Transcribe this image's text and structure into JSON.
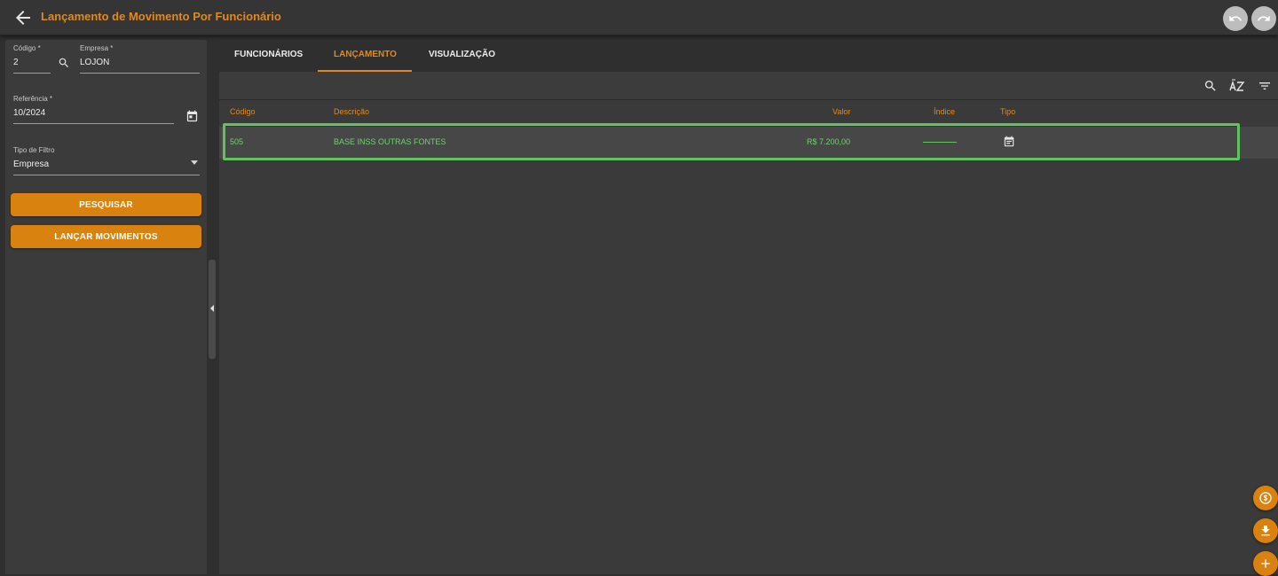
{
  "header": {
    "title": "Lançamento de Movimento Por Funcionário",
    "back_icon": "arrow-left-icon",
    "undo_icon": "undo-icon",
    "redo_icon": "redo-icon",
    "accent_color": "#e08a1e"
  },
  "filters": {
    "codigo": {
      "label": "Código *",
      "value": "2"
    },
    "empresa": {
      "label": "Empresa *",
      "value": "LOJON"
    },
    "referencia": {
      "label": "Referência *",
      "value": "10/2024"
    },
    "tipo_filtro": {
      "label": "Tipo de Filtro",
      "value": "Empresa"
    },
    "search_icon": "search-icon",
    "calendar_icon": "calendar-icon",
    "dropdown_icon": "chevron-down-icon"
  },
  "actions": {
    "pesquisar": "PESQUISAR",
    "lancar": "LANÇAR MOVIMENTOS",
    "button_color": "#d9820f"
  },
  "tabs": [
    {
      "label": "FUNCIONÁRIOS"
    },
    {
      "label": "LANÇAMENTO",
      "active": true
    },
    {
      "label": "VISUALIZAÇÃO"
    }
  ],
  "toolbar": {
    "icons": [
      "search-icon",
      "sort-az-icon",
      "filter-icon"
    ]
  },
  "table": {
    "columns": [
      "Código",
      "Descrição",
      "Valor",
      "Índice",
      "Tipo"
    ],
    "rows": [
      {
        "codigo": "505",
        "descricao": "BASE INSS OUTRAS FONTES",
        "valor": "R$ 7.200,00",
        "indice": "",
        "tipo_icon": "document-icon"
      }
    ],
    "row_text_color": "#72d06e",
    "selection_color": "#5ec45e"
  },
  "fabs": [
    "dollar-icon",
    "download-icon",
    "plus-icon"
  ]
}
